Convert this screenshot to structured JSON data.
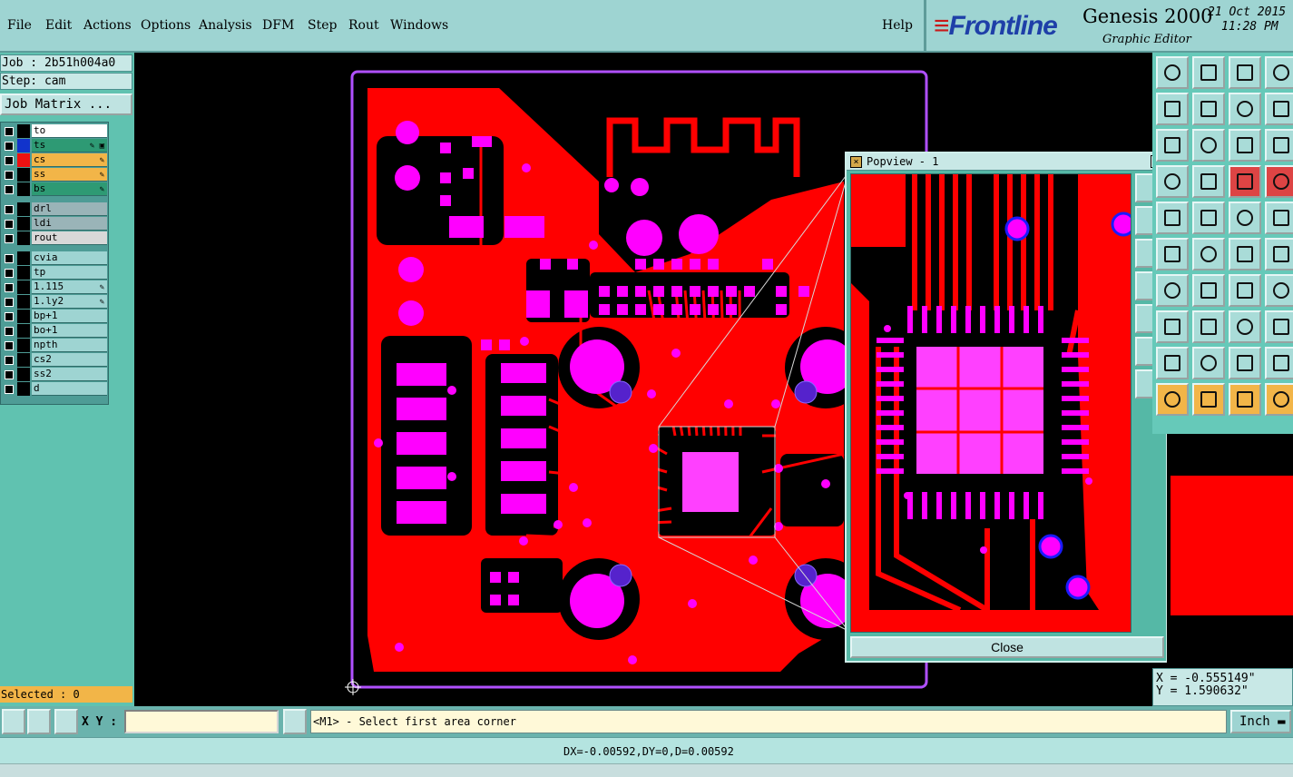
{
  "menu": {
    "items": [
      "File",
      "Edit",
      "Actions",
      "Options",
      "Analysis",
      "DFM",
      "Step",
      "Rout",
      "Windows"
    ],
    "help": "Help"
  },
  "brand": {
    "logo_text": "Frontline",
    "product": "Genesis 2000",
    "subtitle": "Graphic Editor",
    "date": "21 Oct 2015",
    "time": "11:28 PM"
  },
  "left_panel": {
    "job": "Job : 2b51h004a0",
    "step": "Step: cam",
    "job_matrix": "Job Matrix ...",
    "layers": [
      {
        "name": "to",
        "bg": "#ffffff",
        "swatch": "#000000",
        "mark": ""
      },
      {
        "name": "ts",
        "bg": "#2e9a74",
        "swatch": "#1133cc",
        "mark": "✎ ▣"
      },
      {
        "name": "cs",
        "bg": "#f2b548",
        "swatch": "#ee1111",
        "mark": "✎"
      },
      {
        "name": "ss",
        "bg": "#f2b548",
        "swatch": "#000000",
        "mark": "✎"
      },
      {
        "name": "bs",
        "bg": "#2e9a74",
        "swatch": "#000000",
        "mark": "✎"
      },
      {
        "name": "drl",
        "bg": "#9ab4b8",
        "swatch": "#000000",
        "mark": ""
      },
      {
        "name": "ldi",
        "bg": "#9ab4b8",
        "swatch": "#000000",
        "mark": ""
      },
      {
        "name": "rout",
        "bg": "#d8d8d8",
        "swatch": "#000000",
        "mark": ""
      },
      {
        "name": "cvia",
        "bg": "#9ed4d2",
        "swatch": "#000000",
        "mark": ""
      },
      {
        "name": "tp",
        "bg": "#9ed4d2",
        "swatch": "#000000",
        "mark": ""
      },
      {
        "name": "1.115",
        "bg": "#9ed4d2",
        "swatch": "#000000",
        "mark": "✎"
      },
      {
        "name": "1.ly2",
        "bg": "#9ed4d2",
        "swatch": "#000000",
        "mark": "✎"
      },
      {
        "name": "bp+1",
        "bg": "#9ed4d2",
        "swatch": "#000000",
        "mark": ""
      },
      {
        "name": "bo+1",
        "bg": "#9ed4d2",
        "swatch": "#000000",
        "mark": ""
      },
      {
        "name": "npth",
        "bg": "#9ed4d2",
        "swatch": "#000000",
        "mark": ""
      },
      {
        "name": "cs2",
        "bg": "#9ed4d2",
        "swatch": "#000000",
        "mark": ""
      },
      {
        "name": "ss2",
        "bg": "#9ed4d2",
        "swatch": "#000000",
        "mark": ""
      },
      {
        "name": "d",
        "bg": "#9ed4d2",
        "swatch": "#000000",
        "mark": ""
      }
    ],
    "selected": "Selected : 0"
  },
  "popview": {
    "title": "Popview - 1",
    "close_label": "Close"
  },
  "coords": {
    "x": "X = -0.555149\"",
    "y": "Y =  1.590632\""
  },
  "command": {
    "xy_label": "X Y :",
    "xy_value": "",
    "prompt": "<M1> - Select first area corner",
    "unit": "Inch"
  },
  "status": {
    "text": "DX=-0.00592,DY=0,D=0.00592"
  },
  "colors": {
    "copper": "#ff0000",
    "pad": "#ff00ff",
    "via_ring": "#1a1aff",
    "outline": "#b050ff",
    "panel": "#9ed4d2"
  }
}
